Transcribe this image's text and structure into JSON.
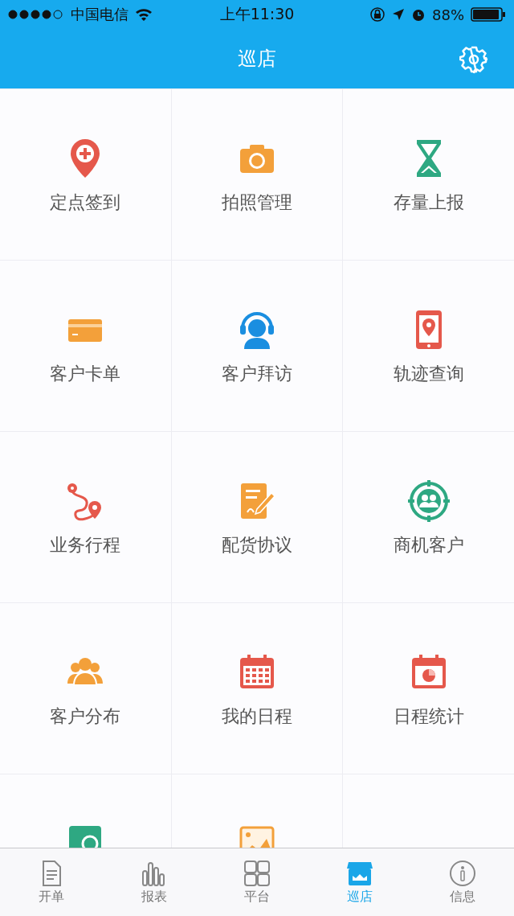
{
  "status_bar": {
    "carrier": "中国电信",
    "time": "上午11:30",
    "battery": "88%"
  },
  "nav_bar": {
    "title": "巡店"
  },
  "grid": [
    {
      "kind": "pin",
      "label": "定点签到"
    },
    {
      "kind": "camera",
      "label": "拍照管理"
    },
    {
      "kind": "hourglass",
      "label": "存量上报"
    },
    {
      "kind": "card",
      "label": "客户卡单"
    },
    {
      "kind": "headset",
      "label": "客户拜访"
    },
    {
      "kind": "phone",
      "label": "轨迹查询"
    },
    {
      "kind": "route",
      "label": "业务行程"
    },
    {
      "kind": "contract",
      "label": "配货协议"
    },
    {
      "kind": "target",
      "label": "商机客户"
    },
    {
      "kind": "people",
      "label": "客户分布"
    },
    {
      "kind": "calendar",
      "label": "我的日程"
    },
    {
      "kind": "chart-calendar",
      "label": "日程统计"
    },
    {
      "kind": "green-tile"
    },
    {
      "kind": "image"
    },
    {
      "kind": "empty"
    }
  ],
  "tab_bar": [
    {
      "kind": "document",
      "label": "开单",
      "selected": false
    },
    {
      "kind": "bars",
      "label": "报表",
      "selected": false
    },
    {
      "kind": "grid",
      "label": "平台",
      "selected": false
    },
    {
      "kind": "store",
      "label": "巡店",
      "selected": true
    },
    {
      "kind": "info",
      "label": "信息",
      "selected": false
    }
  ]
}
